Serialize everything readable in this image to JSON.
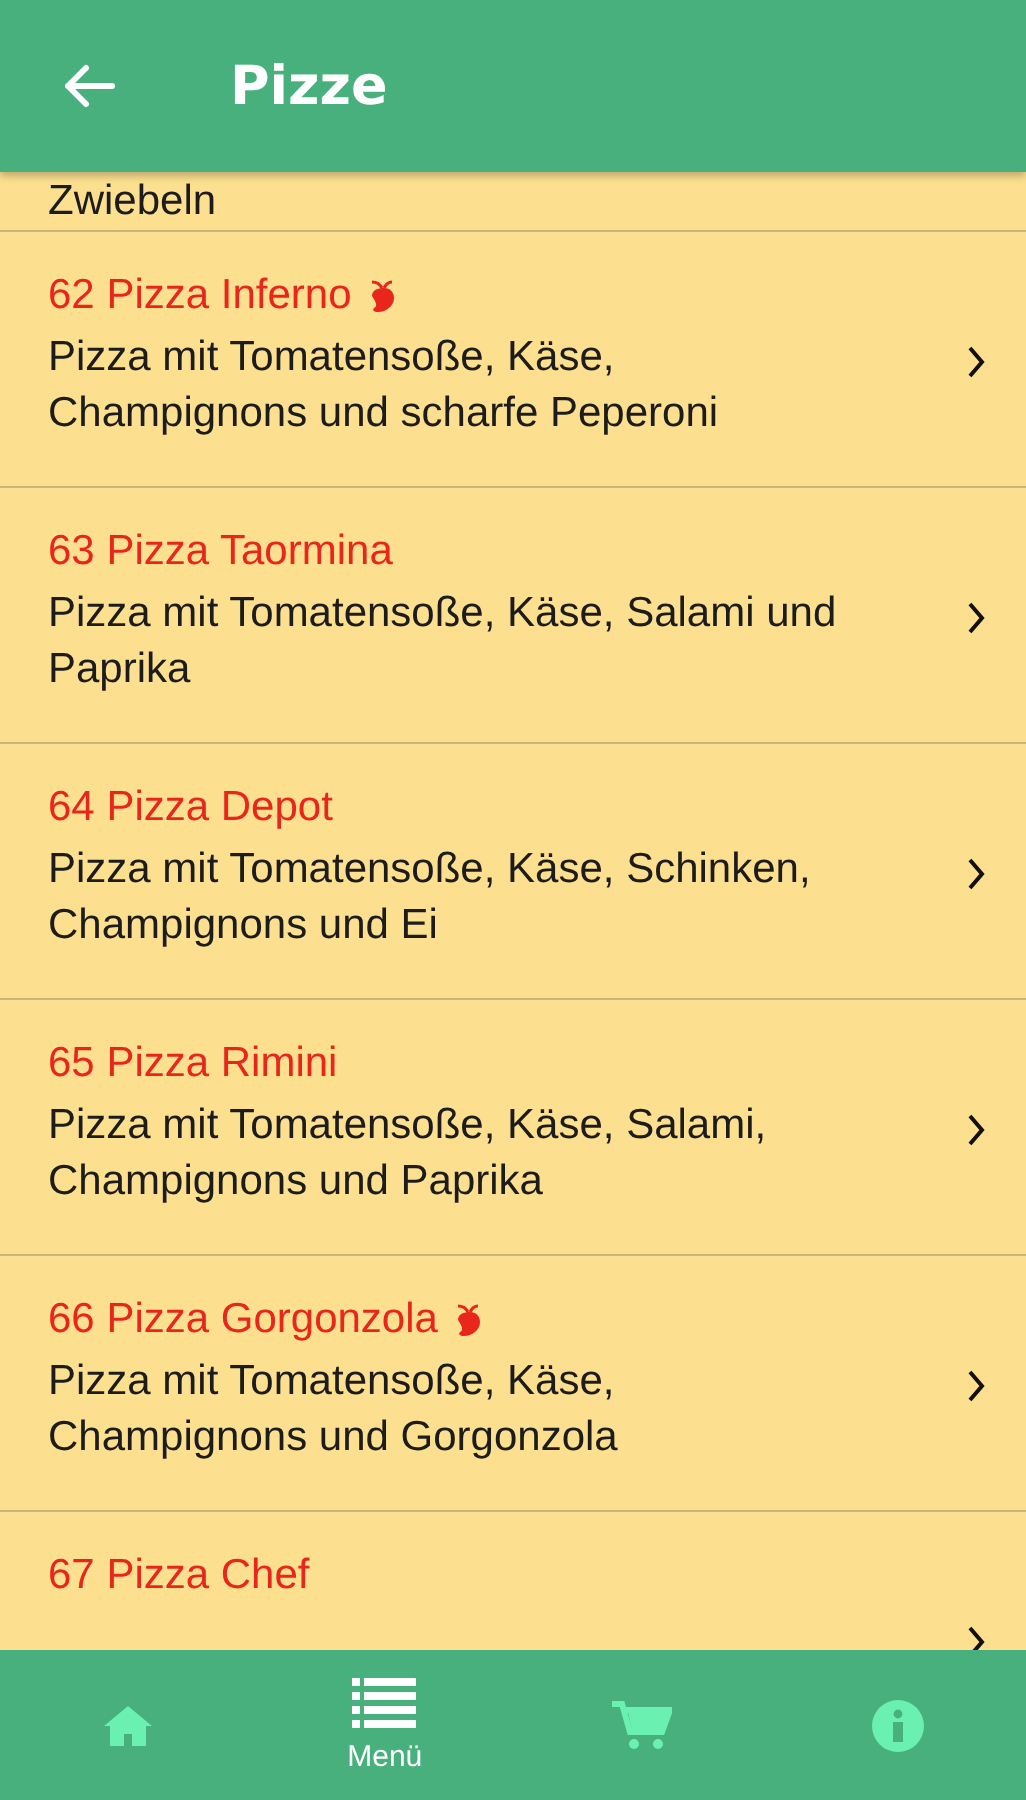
{
  "header": {
    "title": "Pizze"
  },
  "partial_item": {
    "description_tail": "Zwiebeln"
  },
  "items": [
    {
      "title": "62 Pizza Inferno",
      "spicy": true,
      "description": "Pizza mit Tomatensoße, Käse, Champignons und scharfe Peperoni"
    },
    {
      "title": "63 Pizza Taormina",
      "spicy": false,
      "description": "Pizza mit Tomatensoße, Käse, Salami und Paprika"
    },
    {
      "title": "64 Pizza Depot",
      "spicy": false,
      "description": "Pizza mit Tomatensoße, Käse, Schinken, Champignons und Ei"
    },
    {
      "title": "65 Pizza Rimini",
      "spicy": false,
      "description": "Pizza mit Tomatensoße, Käse, Salami, Champignons und Paprika"
    },
    {
      "title": "66 Pizza Gorgonzola",
      "spicy": true,
      "description": "Pizza mit Tomatensoße, Käse, Champignons und Gorgonzola"
    },
    {
      "title": "67 Pizza Chef",
      "spicy": false
    }
  ],
  "bottom_nav": [
    {
      "kind": "home",
      "selected": false
    },
    {
      "kind": "menu",
      "label": "Menü",
      "selected": true
    },
    {
      "kind": "cart",
      "selected": false
    },
    {
      "kind": "info",
      "selected": false
    }
  ]
}
